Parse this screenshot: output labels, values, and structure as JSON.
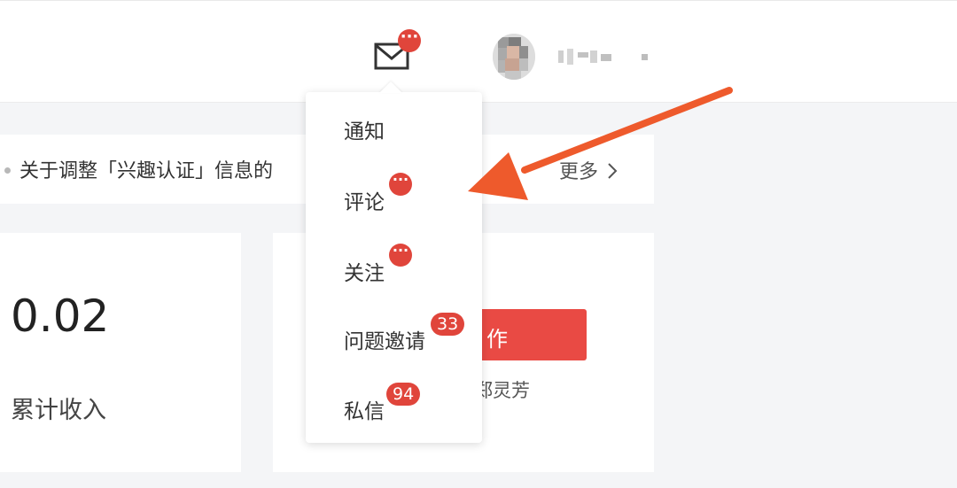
{
  "header": {
    "mail_badge": "···",
    "username": "",
    "mail_icon": "envelope-icon",
    "avatar_icon": "avatar"
  },
  "announcement": {
    "text": "关于调整「兴趣认证」信息的",
    "more_label": "更多",
    "more_icon": "chevron-right-icon"
  },
  "stats": {
    "income_value": "0.02",
    "income_label": "累计收入"
  },
  "create": {
    "button_label": "作",
    "author_name": "郑灵芳"
  },
  "messages_menu": {
    "items": [
      {
        "label": "通知",
        "badge": ""
      },
      {
        "label": "评论",
        "badge": "···"
      },
      {
        "label": "关注",
        "badge": "···"
      },
      {
        "label": "问题邀请",
        "badge": "33"
      },
      {
        "label": "私信",
        "badge": "94"
      }
    ]
  },
  "colors": {
    "accent": "#e94a44",
    "badge": "#e0453b",
    "annotation_arrow": "#ee5a2c"
  }
}
